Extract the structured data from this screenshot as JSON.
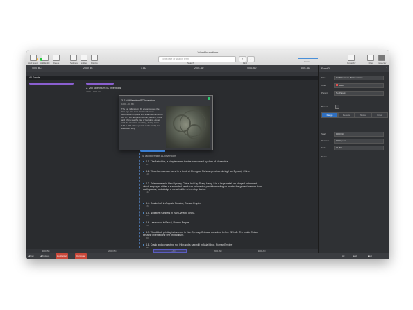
{
  "window": {
    "title": "World Inventions"
  },
  "toolbar": {
    "add_event": "Add Event",
    "add_entity": "Add Entity",
    "delete": "Delete",
    "settings": "Settings",
    "entities": "Entities",
    "display": "Display",
    "search_placeholder": "Type date or search term",
    "search_label": "Search",
    "find": "Find",
    "zoom": "Zoom",
    "group_by": "Group by",
    "filter": "Filter",
    "inspector": "Inspector"
  },
  "ruler": {
    "ticks": [
      "4000 BC",
      "2000 BC",
      "1 AD",
      "2001 AD",
      "4001 AD",
      "6001 AD"
    ]
  },
  "timeline": {
    "all_events": "All Events",
    "event2_title": "2. 2nd Millennium BC Inventions",
    "event2_sub": "2000 – 1001 BC",
    "card": {
      "title": "3. 1st Millennium BC Inventions",
      "sub": "1000 – 01 BC",
      "desc": "The 1st millennium BC encompasses the Iron Age and sees the rise of many successive empires, and spanned from 1000 BC to 1 BC. Empires Roman, Greece, India and China see the rise of literature. Along with the invention of writing, during some 170 to 400 million people in the world, the estimates vary."
    },
    "group_title": "4. 1st Millennium AD Inventions",
    "items": [
      {
        "text": "4.1. The Astrolabe, a simple steam turbine is recorded by Hero of Alexandria",
        "year": "50"
      },
      {
        "text": "4.2. Wheelbarrow was found in a tomb at Chengdu, Sichuan province during Han Dynasty China",
        "year": "118"
      },
      {
        "text": "4.3. Seismometer in Han Dynasty China, built by Zhang Heng. It is a large metal urn-shaped instrument which employed either a suspended pendulum or inverted pendulum acting on inertia, the ground tremors from earthquakes, to dislodge a metal ball by a lever trip device.",
        "year": "132"
      },
      {
        "text": "4.4. Crankshaft in Augusta Raurica, Roman Empire",
        "year": "150"
      },
      {
        "text": "4.5. Negative numbers in Han Dynasty China.",
        "year": "200"
      },
      {
        "text": "4.6. Lee school in Beirut, Roman Empire",
        "year": "250"
      },
      {
        "text": "4.7. Woodblock printing is invented in Han Dynasty China at sometime before 220 AD. The inside China became invented the first print culture.",
        "year": "300"
      },
      {
        "text": "4.8. Crank and connecting rod (Hierapolis sawmill) in Asia Minor, Roman Empire",
        "year": "350"
      }
    ]
  },
  "bottom_ruler": {
    "ticks": [
      "4000 BC",
      "2000 BC",
      "1 AD",
      "2001 AD",
      "4001 AD"
    ]
  },
  "status": {
    "prev": "Prev",
    "previous": "Previous",
    "tag1": "Horizontal",
    "tag2": "Computer",
    "right": "All",
    "next": "Next",
    "last": "Last"
  },
  "inspector": {
    "header": "Event 3",
    "title_label": "Title",
    "title_value": "1st Millennium BC Inventions",
    "color_label": "Color",
    "color_value": "Red",
    "parent_label": "Parent",
    "parent_value": "No Parent",
    "tab_range": "Range",
    "tab_results": "Results",
    "tab_notes": "Notes",
    "tab_links": "Links",
    "based_label": "Based",
    "start_label": "Start",
    "start_value": "1000 BC",
    "duration_label": "Duration",
    "duration_value": "1000 years",
    "end_label": "End",
    "end_value": "01 BC",
    "notes_label": "Notes"
  },
  "colors": {
    "accent": "#3a7ed1",
    "bar": "#8a5fd0",
    "tag": "#c9483a"
  }
}
